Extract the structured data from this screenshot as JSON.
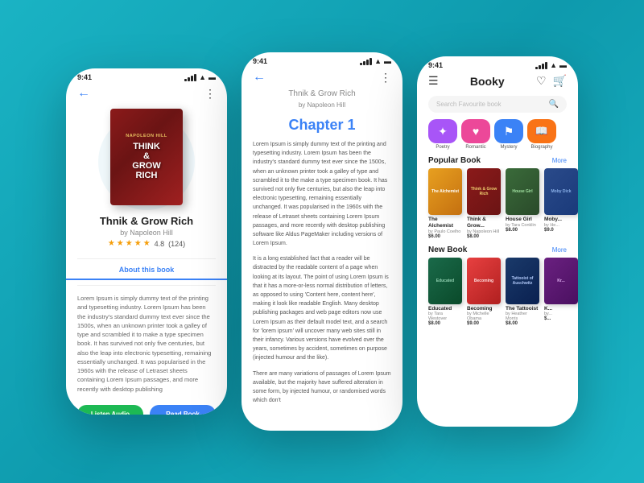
{
  "app": {
    "name": "Booky"
  },
  "phone_left": {
    "status_time": "9:41",
    "book": {
      "title": "Thnik & Grow Rich",
      "author": "by Napoleon Hill",
      "rating": "4.8",
      "rating_count": "(124)",
      "about_tab": "About this book",
      "description": "Lorem Ipsum is simply dummy text of the printing and typesetting industry. Lorem Ipsum has been the industry's standard dummy text ever since the 1500s, when an unknown printer took a galley of type and scrambled it to make a type specimen book. It has survived not only five centuries, but also the leap into electronic typesetting, remaining essentially unchanged. It was popularised in the 1960s with the release of Letraset sheets containing Lorem Ipsum passages, and more recently with desktop publishing",
      "btn_listen": "Listen Audio",
      "btn_read": "Read Book"
    }
  },
  "phone_mid": {
    "status_time": "9:41",
    "book_title": "Thnik & Grow Rich",
    "book_author": "by Napoleon Hill",
    "chapter": "Chapter 1",
    "text_para1": "Lorem Ipsum is simply dummy text of the printing and typesetting industry. Lorem Ipsum has been the industry's standard dummy text ever since the 1500s, when an unknown printer took a galley of type and scrambled it to the make a type specimen book. It has survived not only five centuries, but also the leap into electronic typesetting, remaining essentially unchanged. It was popularised in the 1960s with the release of Letraset sheets containing Lorem Ipsum passages, and more recently with desktop publishing software like Aldus PageMaker including versions of Lorem Ipsum.",
    "text_para2": "It is a long established fact that a reader will be distracted by the readable content of a page when looking at its layout. The point of using Lorem Ipsum is that it has a more-or-less normal distribution of letters, as opposed to using 'Content here, content here', making it look like readable English. Many desktop publishing packages and web page editors now use Lorem Ipsum as their default model text, and a search for 'lorem ipsum' will uncover many web sites still in their infancy. Various versions have evolved over the years, sometimes by accident, sometimes on purpose (injected humour and the like).",
    "text_para3": "There are many variations of passages of Lorem Ipsum available, but the majority have suffered alteration in some form, by injected humour, or randomised words which don't"
  },
  "phone_right": {
    "status_time": "9:41",
    "search_placeholder": "Search Favourite book",
    "categories": [
      {
        "label": "Poetry",
        "icon": "✦",
        "color": "#a855f7"
      },
      {
        "label": "Romantic",
        "icon": "♥",
        "color": "#ec4899"
      },
      {
        "label": "Mystery",
        "icon": "⚑",
        "color": "#3b82f6"
      },
      {
        "label": "Biography",
        "icon": "☰",
        "color": "#f97316"
      }
    ],
    "popular_section": "Popular Book",
    "more_label": "More",
    "popular_books": [
      {
        "title": "The Alchemist",
        "author": "by Paulo Coelho",
        "price": "$6.00",
        "cover_style": "alchemist"
      },
      {
        "title": "Think & Grow...",
        "author": "by Napoleon Hill",
        "price": "$8.00",
        "cover_style": "thinkgrow"
      },
      {
        "title": "House Girl",
        "author": "by Tara Conklin",
        "price": "$8.00",
        "cover_style": "housegirl"
      },
      {
        "title": "Moby...",
        "author": "by He...",
        "price": "$9.0",
        "cover_style": "moby"
      }
    ],
    "new_section": "New Book",
    "new_books": [
      {
        "title": "Educated",
        "author": "by Tara Westover",
        "price": "$8.00",
        "cover_style": "educated"
      },
      {
        "title": "Becoming",
        "author": "by Michelle Obama",
        "price": "$9.00",
        "cover_style": "becoming"
      },
      {
        "title": "The Tattooist",
        "author": "by Heather Morris",
        "price": "$8.00",
        "cover_style": "tattooist"
      },
      {
        "title": "K...",
        "author": "by...",
        "price": "$...",
        "cover_style": "kr"
      }
    ]
  }
}
